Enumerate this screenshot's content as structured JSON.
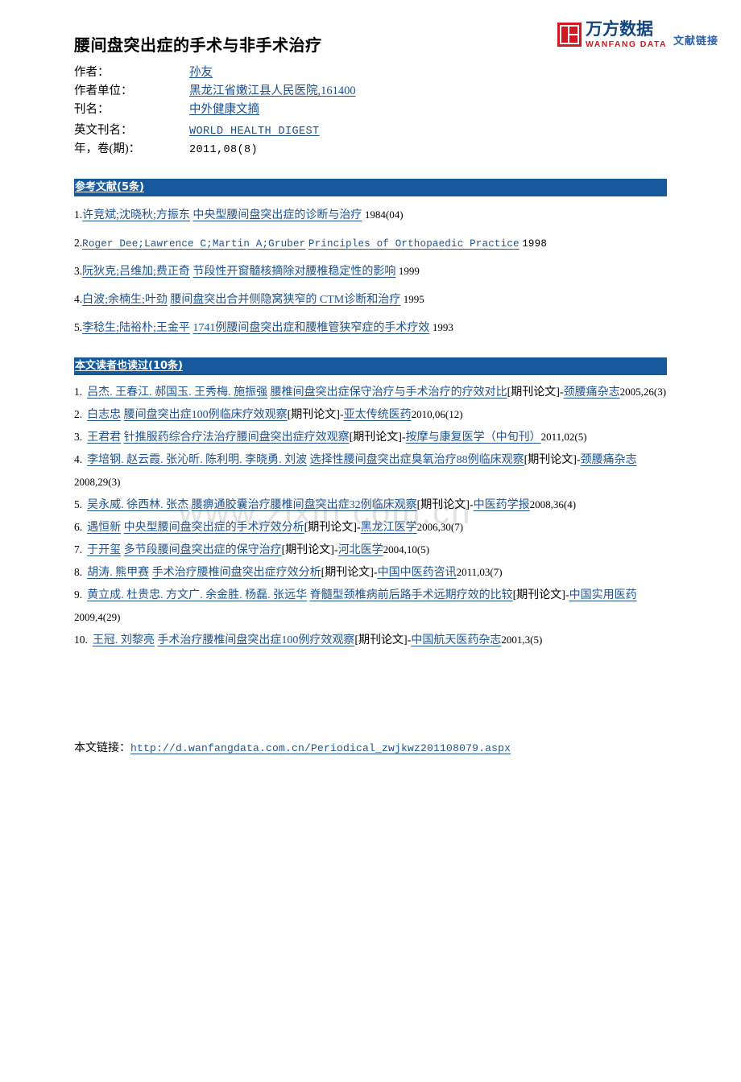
{
  "logo": {
    "icon_name": "wanfang-square-icon",
    "brand_cn": "万方数据",
    "brand_en": "WANFANG DATA",
    "tagline": "文献链接",
    "brand_red": "#d31920",
    "brand_blue": "#14457f"
  },
  "document": {
    "title": "腰间盘突出症的手术与非手术治疗"
  },
  "meta": {
    "rows": [
      {
        "label": "作者：",
        "value": "孙友",
        "link": true,
        "mono": false
      },
      {
        "label": "作者单位：",
        "value": "黑龙江省嫩江县人民医院,161400",
        "link": true,
        "mono": false
      },
      {
        "label": "刊名：",
        "value": "中外健康文摘",
        "link": true,
        "mono": false
      },
      {
        "label": "英文刊名：",
        "value": "WORLD HEALTH DIGEST",
        "link": true,
        "mono": true
      },
      {
        "label": "年，卷(期)：",
        "value": "2011,08(8)",
        "link": false,
        "mono": true
      }
    ]
  },
  "references_section": {
    "header": "参考文献(5条)",
    "accent_color": "#165a9d",
    "items": [
      {
        "num": "1.",
        "authors": "许竞斌;沈晓秋;方振东",
        "title": "中央型腰间盘突出症的诊断与治疗",
        "year": "1984(04)",
        "mono": false
      },
      {
        "num": "2.",
        "authors": "Roger Dee;Lawrence C;Martin A;Gruber",
        "title": "Principles of Orthopaedic Practice",
        "year": "1998",
        "mono": true
      },
      {
        "num": "3.",
        "authors": "阮狄克;吕维加;费正奇",
        "title": "节段性开窗髓核摘除对腰椎稳定性的影响",
        "year": "1999",
        "mono": false
      },
      {
        "num": "4.",
        "authors": "白波;余楠生;叶劲",
        "title": "腰间盘突出合并侧隐窝狭窄的 CTM诊断和治疗",
        "year": "1995",
        "mono": false
      },
      {
        "num": "5.",
        "authors": "李稔生;陆裕朴;王金平",
        "title": "1741例腰间盘突出症和腰椎管狭窄症的手术疗效",
        "year": "1993",
        "mono": false
      }
    ]
  },
  "also_read_section": {
    "header": "本文读者也读过(10条)",
    "accent_color": "#165a9d",
    "items": [
      {
        "num": "1.",
        "authors": "吕杰. 王春江. 郝国玉. 王秀梅. 施振强",
        "title": "腰椎间盘突出症保守治疗与手术治疗的疗效对比",
        "type": "[期刊论文]-",
        "journal": "颈腰痛杂志",
        "tail": "2005,26(3)"
      },
      {
        "num": "2.",
        "authors": "白志忠",
        "title": "腰间盘突出症100例临床疗效观察",
        "type": "[期刊论文]-",
        "journal": "亚太传统医药",
        "tail": "2010,06(12)"
      },
      {
        "num": "3.",
        "authors": "王君君",
        "title": "针推服药综合疗法治疗腰间盘突出症疗效观察",
        "type": "[期刊论文]-",
        "journal": "按摩与康复医学（中旬刊）",
        "tail": "2011,02(5)"
      },
      {
        "num": "4.",
        "authors": "李培钢. 赵云霞. 张沁昕. 陈利明. 李晓勇. 刘波",
        "title": "选择性腰间盘突出症臭氧治疗88例临床观察",
        "type": "[期刊论文]-",
        "journal": "颈腰痛杂志",
        "tail": "2008,29(3)"
      },
      {
        "num": "5.",
        "authors": "吴永威. 徐西林. 张杰",
        "title": "腰痹通胶囊治疗腰椎间盘突出症32例临床观察",
        "type": "[期刊论文]-",
        "journal": "中医药学报",
        "tail": "2008,36(4)"
      },
      {
        "num": "6.",
        "authors": "遇恒新",
        "title": "中央型腰间盘突出症的手术疗效分析",
        "type": "[期刊论文]-",
        "journal": "黑龙江医学",
        "tail": "2006,30(7)"
      },
      {
        "num": "7.",
        "authors": "于开玺",
        "title": "多节段腰间盘突出症的保守治疗",
        "type": "[期刊论文]-",
        "journal": "河北医学",
        "tail": "2004,10(5)"
      },
      {
        "num": "8.",
        "authors": "胡涛. 熊甲赛",
        "title": "手术治疗腰椎间盘突出症疗效分析",
        "type": "[期刊论文]-",
        "journal": "中国中医药咨讯",
        "tail": "2011,03(7)"
      },
      {
        "num": "9.",
        "authors": "黄立成. 杜贵忠. 方文广. 余金胜. 杨磊. 张远华",
        "title": "脊髓型颈椎病前后路手术远期疗效的比较",
        "type": "[期刊论文]-",
        "journal": "中国实用医药",
        "tail": "2009,4(29)"
      },
      {
        "num": "10.",
        "authors": "王冠. 刘黎亮",
        "title": "手术治疗腰椎间盘突出症100例疗效观察",
        "type": "[期刊论文]-",
        "journal": "中国航天医药杂志",
        "tail": "2001,3(5)"
      }
    ]
  },
  "footer": {
    "label": "本文链接：",
    "url": "http://d.wanfangdata.com.cn/Periodical_zwjkwz201108079.aspx"
  },
  "watermark": {
    "text": "www.zixin.com.cn"
  }
}
